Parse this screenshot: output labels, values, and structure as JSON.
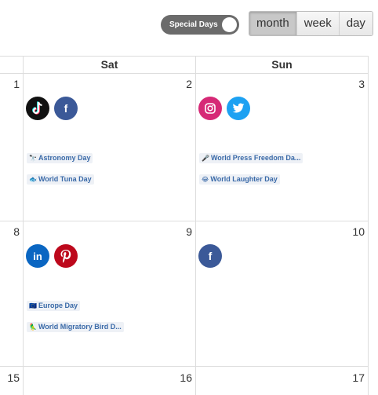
{
  "toolbar": {
    "toggle_label": "Special Days",
    "views": [
      {
        "label": "month",
        "active": true
      },
      {
        "label": "week",
        "active": false
      },
      {
        "label": "day",
        "active": false
      }
    ]
  },
  "calendar": {
    "headers": [
      "Sat",
      "Sun"
    ],
    "days": {
      "d1": "1",
      "d2": "2",
      "d3": "3",
      "d8": "8",
      "d9": "9",
      "d10": "10",
      "d15": "15",
      "d16": "16",
      "d17": "17"
    },
    "events": {
      "e2a": {
        "emoji": "🔭",
        "title": "Astronomy Day"
      },
      "e2b": {
        "emoji": "🐟",
        "title": "World Tuna Day"
      },
      "e3a": {
        "emoji": "🎤",
        "title": "World Press Freedom Da..."
      },
      "e3b": {
        "emoji": "😂",
        "title": "World Laughter Day"
      },
      "e9a": {
        "emoji": "🇪🇺",
        "title": "Europe Day"
      },
      "e9b": {
        "emoji": "🦜",
        "title": "World Migratory Bird D..."
      }
    },
    "social": {
      "tiktok": "tiktok-icon",
      "facebook": "facebook-icon",
      "instagram": "instagram-icon",
      "twitter": "twitter-icon",
      "linkedin": "linkedin-icon",
      "pinterest": "pinterest-icon"
    }
  },
  "colors": {
    "toggle_bg": "#6b6b6b",
    "tiktok": "#111111",
    "facebook": "#3b5998",
    "instagram": "#d62976",
    "twitter": "#1da1f2",
    "linkedin": "#0a66c2",
    "pinterest": "#bd081c",
    "event_text": "#3a6aa8",
    "event_bg": "#eef1f6"
  }
}
